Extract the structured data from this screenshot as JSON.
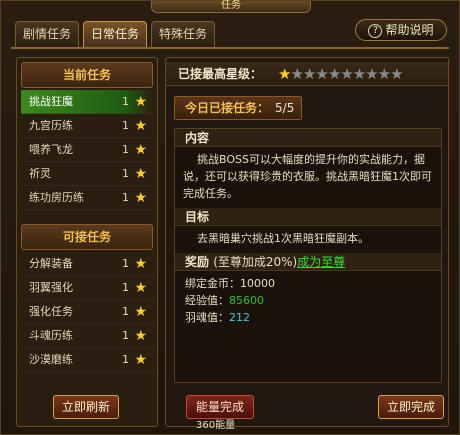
{
  "window": {
    "title": "任务"
  },
  "tabs": [
    {
      "label": "剧情任务"
    },
    {
      "label": "日常任务"
    },
    {
      "label": "特殊任务"
    }
  ],
  "help": {
    "label": "帮助说明",
    "icon": "question-icon"
  },
  "current_tasks": {
    "header": "当前任务",
    "items": [
      {
        "name": "挑战狂魔",
        "count": "1"
      },
      {
        "name": "九宫历练",
        "count": "1"
      },
      {
        "name": "喂养飞龙",
        "count": "1"
      },
      {
        "name": "祈灵",
        "count": "1"
      },
      {
        "name": "练功房历练",
        "count": "1"
      }
    ]
  },
  "available_tasks": {
    "header": "可接任务",
    "items": [
      {
        "name": "分解装备",
        "count": "1"
      },
      {
        "name": "羽翼强化",
        "count": "1"
      },
      {
        "name": "强化任务",
        "count": "1"
      },
      {
        "name": "斗魂历练",
        "count": "1"
      },
      {
        "name": "沙漠磨练",
        "count": "1"
      }
    ]
  },
  "refresh_label": "立即刷新",
  "highest_star": {
    "label": "已接最高星级：",
    "filled": 1,
    "total": 10
  },
  "today": {
    "label": "今日已接任务：",
    "value": "5/5"
  },
  "content": {
    "header": "内容",
    "text": "挑战BOSS可以大幅度的提升你的实战能力，据说，还可以获得珍贵的衣服。挑战黑暗狂魔1次即可完成任务。"
  },
  "goal": {
    "header": "目标",
    "text": "去黑暗巢穴挑战1次黑暗狂魔副本。"
  },
  "reward": {
    "header": "奖励",
    "bonus": "(至尊加成20%)",
    "link": "成为至尊",
    "gold_label": "绑定金币：",
    "gold_value": "10000",
    "exp_label": "经验值：",
    "exp_value": "85600",
    "soul_label": "羽魂值：",
    "soul_value": "212"
  },
  "energy_button": "能量完成",
  "energy_cost": "360能量",
  "finish_button": "立即完成",
  "colors": {
    "accent": "#f0c050",
    "selected": "#3c8a1c",
    "star": "#ffd020",
    "green": "#30c030",
    "cyan": "#40c8d0"
  }
}
